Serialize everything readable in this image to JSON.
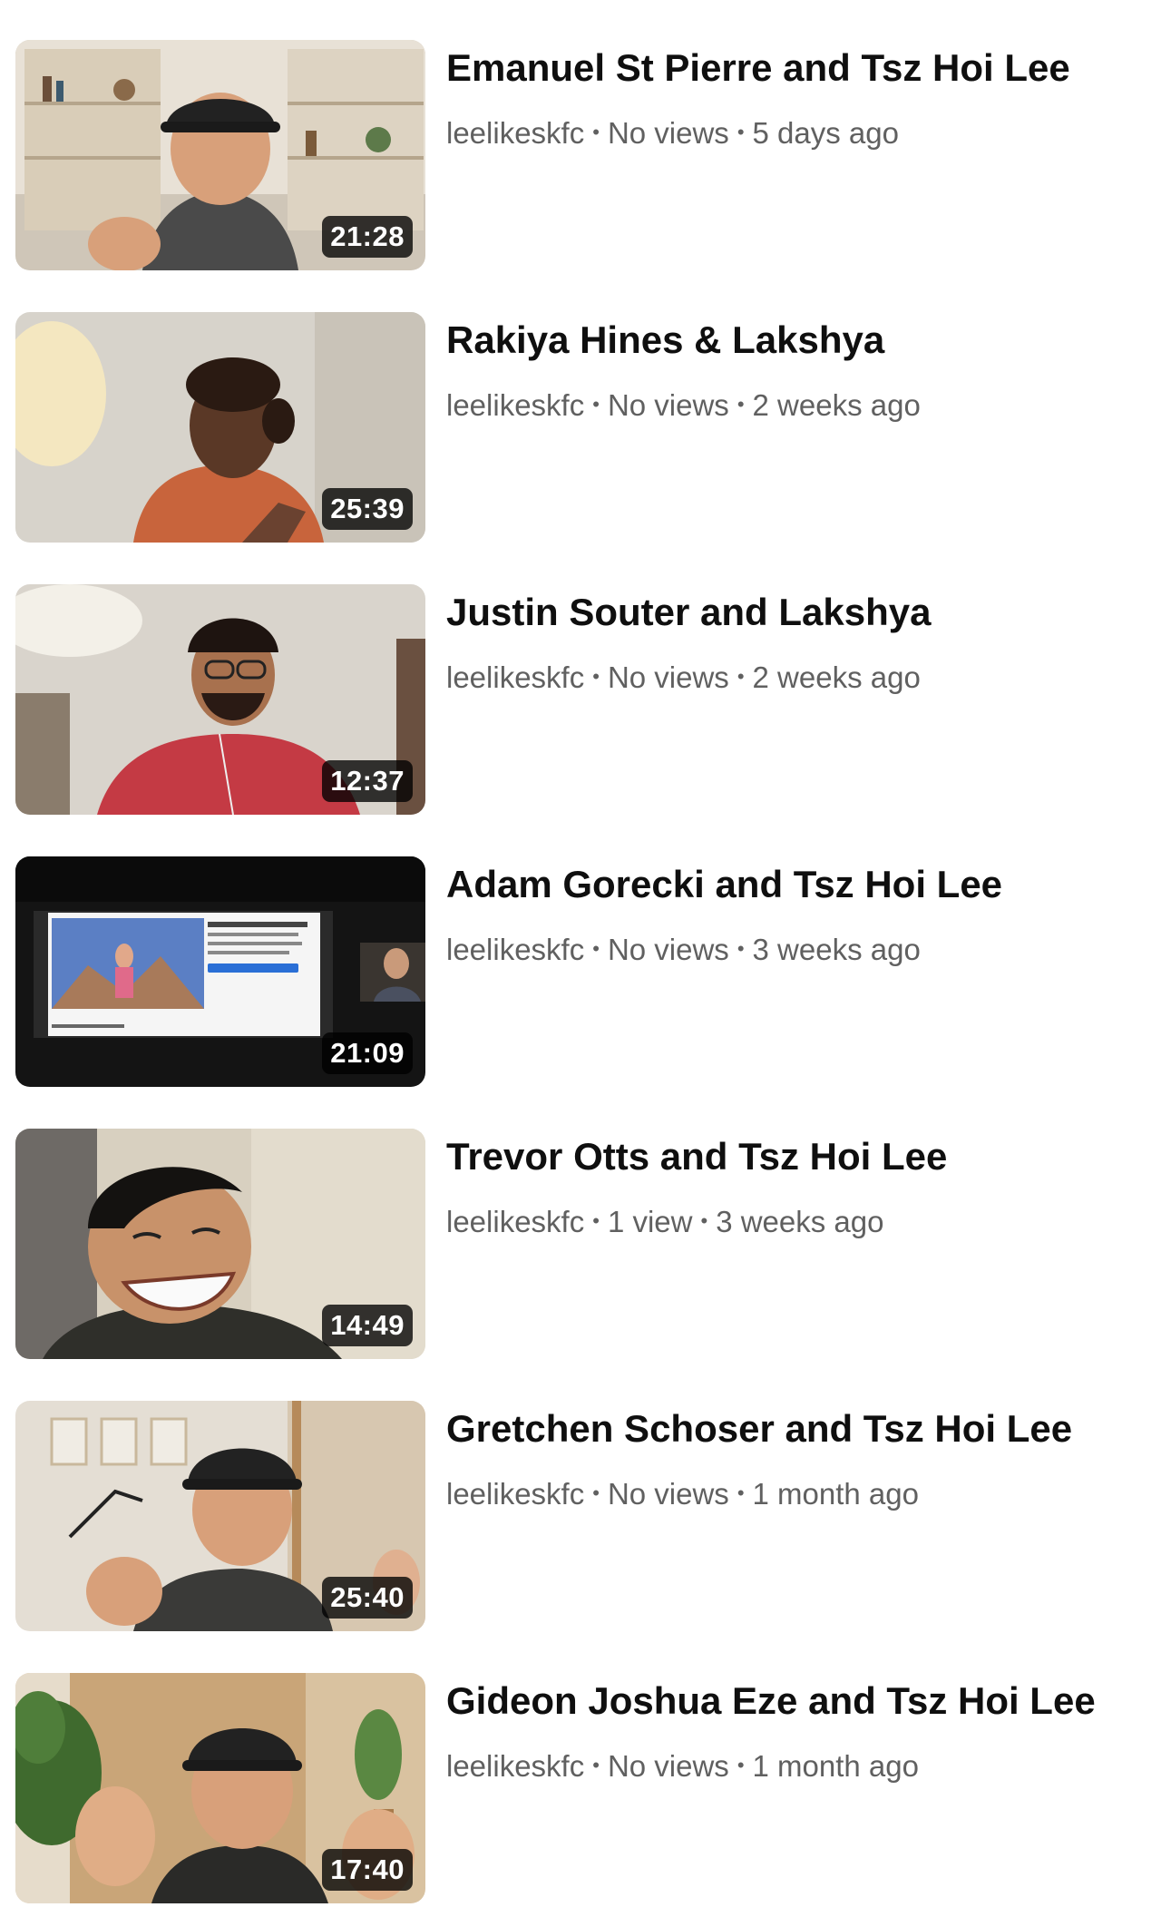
{
  "videos": [
    {
      "title": "Emanuel St Pierre and Tsz Hoi Lee",
      "channel": "leelikeskfc",
      "views": "No views",
      "age": "5 days ago",
      "duration": "21:28",
      "thumbnail_icon": "video-thumbnail-man-bookshelf"
    },
    {
      "title": "Rakiya Hines & Lakshya",
      "channel": "leelikeskfc",
      "views": "No views",
      "age": "2 weeks ago",
      "duration": "25:39",
      "thumbnail_icon": "video-thumbnail-woman-orange-sweater"
    },
    {
      "title": "Justin Souter and Lakshya",
      "channel": "leelikeskfc",
      "views": "No views",
      "age": "2 weeks ago",
      "duration": "12:37",
      "thumbnail_icon": "video-thumbnail-man-glasses-red-shirt"
    },
    {
      "title": "Adam Gorecki and Tsz Hoi Lee",
      "channel": "leelikeskfc",
      "views": "No views",
      "age": "3 weeks ago",
      "duration": "21:09",
      "thumbnail_icon": "video-thumbnail-screen-share"
    },
    {
      "title": "Trevor Otts and Tsz Hoi Lee",
      "channel": "leelikeskfc",
      "views": "1 view",
      "age": "3 weeks ago",
      "duration": "14:49",
      "thumbnail_icon": "video-thumbnail-man-laughing"
    },
    {
      "title": "Gretchen Schoser and Tsz Hoi Lee",
      "channel": "leelikeskfc",
      "views": "No views",
      "age": "1 month ago",
      "duration": "25:40",
      "thumbnail_icon": "video-thumbnail-man-cap-gesturing"
    },
    {
      "title": "Gideon Joshua Eze and Tsz Hoi Lee",
      "channel": "leelikeskfc",
      "views": "No views",
      "age": "1 month ago",
      "duration": "17:40",
      "thumbnail_icon": "video-thumbnail-man-cap-plants"
    }
  ],
  "separator": "•",
  "colors": {
    "title": "#0f0f0f",
    "meta": "#606060",
    "duration_bg": "#000000c7",
    "duration_text": "#ffffff"
  }
}
